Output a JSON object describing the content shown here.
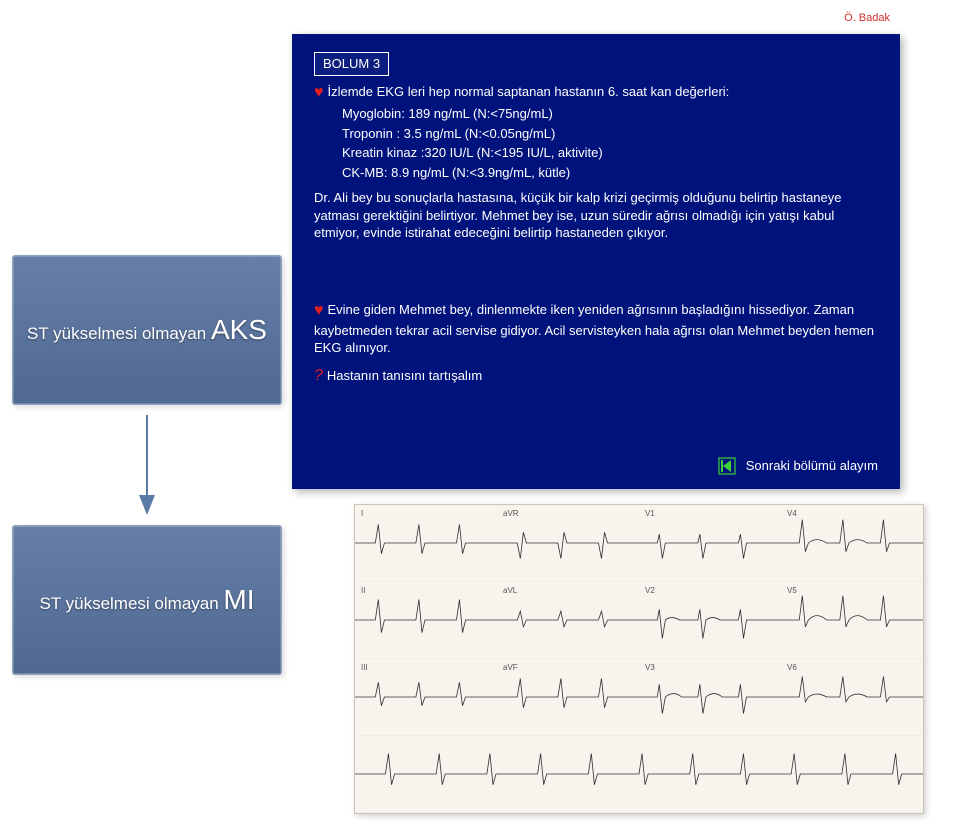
{
  "author": "Ö. Badak",
  "boxes": {
    "aks_prefix": "ST yükselmesi olmayan ",
    "aks_big": "AKS",
    "mi_prefix": "ST yükselmesi olmayan ",
    "mi_big": "MI"
  },
  "slide": {
    "section": "BOLUM 3",
    "line1": "İzlemde EKG leri hep normal saptanan hastanın 6. saat kan değerleri:",
    "values": {
      "myo": "Myoglobin: 189 ng/mL (N:<75ng/mL)",
      "trop": "Troponin : 3.5 ng/mL (N:<0.05ng/mL)",
      "ck": "Kreatin kinaz :320 IU/L (N:<195 IU/L, aktivite)",
      "ckmb": "CK-MB: 8.9 ng/mL (N:<3.9ng/mL, kütle)"
    },
    "para1": "Dr. Ali bey bu sonuçlarla hastasına, küçük bir kalp krizi geçirmiş olduğunu belirtip hastaneye yatması gerektiğini belirtiyor. Mehmet bey ise, uzun süredir ağrısı olmadığı için yatışı kabul etmiyor, evinde istirahat edeceğini belirtip hastaneden çıkıyor.",
    "para2": "Evine giden Mehmet bey, dinlenmekte iken yeniden ağrısının başladığını hissediyor. Zaman kaybetmeden tekrar acil servise gidiyor. Acil servisteyken hala ağrısı olan Mehmet beyden hemen EKG alınıyor.",
    "question": "Hastanın tanısını tartışalım",
    "nav": "Sonraki bölümü alayım"
  },
  "ecg": {
    "leads": [
      "I",
      "aVR",
      "V1",
      "V4",
      "II",
      "aVL",
      "V2",
      "V5",
      "III",
      "aVF",
      "V3",
      "V6"
    ]
  }
}
